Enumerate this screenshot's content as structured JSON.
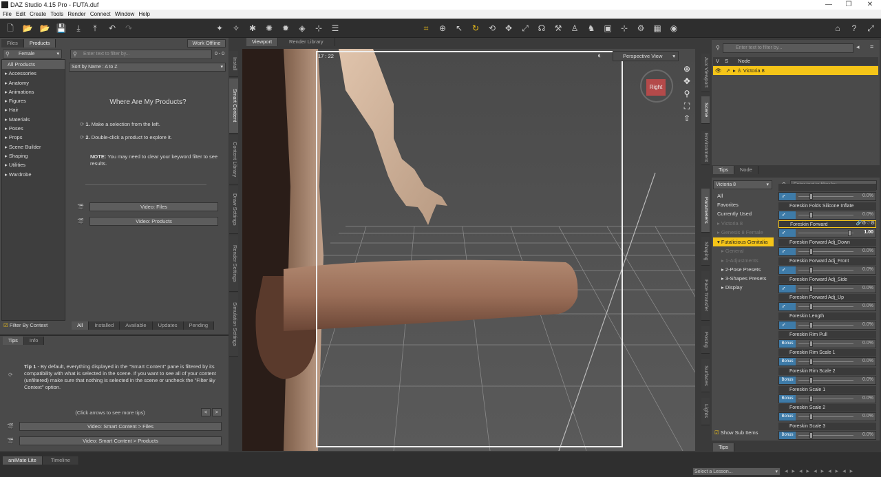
{
  "window": {
    "title": "DAZ Studio 4.15 Pro - FUTA.duf"
  },
  "menu": [
    "File",
    "Edit",
    "Create",
    "Tools",
    "Render",
    "Connect",
    "Window",
    "Help"
  ],
  "left": {
    "tabs": [
      "Files",
      "Products"
    ],
    "work_offline": "Work Offline",
    "category_select": "Female",
    "filter_placeholder": "Enter text to filter by...",
    "count": "0 - 0",
    "sort": "Sort by Name : A to Z",
    "categories": [
      "All Products",
      "Accessories",
      "Anatomy",
      "Animations",
      "Figures",
      "Hair",
      "Materials",
      "Poses",
      "Props",
      "Scene Builder",
      "Shaping",
      "Utilities",
      "Wardrobe"
    ],
    "where_title": "Where Are My Products?",
    "step1_num": "1.",
    "step1": "Make a selection from the left.",
    "step2_num": "2.",
    "step2": "Double-click a product to explore it.",
    "note_label": "NOTE:",
    "note": "You may need to clear your keyword filter to see results.",
    "video_files": "Video: Files",
    "video_products": "Video: Products",
    "filter_by_context": "Filter By Context",
    "bottom_tabs": [
      "All",
      "Installed",
      "Available",
      "Updates",
      "Pending"
    ]
  },
  "tips": {
    "tabs": [
      "Tips",
      "Info"
    ],
    "tip_label": "Tip 1",
    "tip_text": " - By default, everything displayed in the \"Smart Content\" pane is filtered by its compatibility with what is selected in the scene. If you want to see all of your content (unfiltered) make sure that nothing is selected in the scene or uncheck the \"Filter By Context\" option.",
    "more": "(Click arrows to see more tips)",
    "prev": "<",
    "next": ">",
    "video1": "Video: Smart Content > Files",
    "video2": "Video: Smart Content > Products"
  },
  "side_tabs_left": [
    "Install",
    "Smart Content",
    "Content Library",
    "Draw Settings",
    "Render Settings",
    "Simulation Settings"
  ],
  "viewport": {
    "tabs": [
      "Viewport",
      "Render Library"
    ],
    "frame": "17 : 22",
    "view": "Perspective View",
    "cube_label": "Right"
  },
  "scene": {
    "filter_placeholder": "Enter text to filter by...",
    "col_v": "V",
    "col_s": "S",
    "col_node": "Node",
    "node": "Victoria 8",
    "tabs": [
      "Tips",
      "Node"
    ]
  },
  "side_tabs_right": [
    "Aux Viewport",
    "Scene",
    "Environment",
    "Parameters",
    "Shaping",
    "Face Transfer",
    "Posing",
    "Surfaces",
    "Lights"
  ],
  "params": {
    "figure": "Victoria 8",
    "filter_placeholder": "Enter text to filter by...",
    "groups": [
      "All",
      "Favorites",
      "Currently Used",
      "Victoria 8",
      "Genesis 8 Female",
      "Futalicious Genitalia",
      "General",
      "1-Adjustments",
      "2-Pose Presets",
      "3-Shapes Presets",
      "Display"
    ],
    "show_sub": "Show Sub Items",
    "tips": "Tips",
    "items": [
      {
        "label": "",
        "value": "0.0%",
        "knob": 0.2
      },
      {
        "label": "Foreskin Folds Silicone Inflate",
        "value": "0.0%",
        "knob": 0.2
      },
      {
        "label": "Foreskin Forward",
        "value": "1.00",
        "knob": 0.9
      },
      {
        "label": "Foreskin Forward Adj_Down",
        "value": "0.0%",
        "knob": 0.2
      },
      {
        "label": "Foreskin Forward Adj_Front",
        "value": "0.0%",
        "knob": 0.2
      },
      {
        "label": "Foreskin Forward Adj_Side",
        "value": "0.0%",
        "knob": 0.2
      },
      {
        "label": "Foreskin Forward Adj_Up",
        "value": "0.0%",
        "knob": 0.2
      },
      {
        "label": "Foreskin Length",
        "value": "0.0%",
        "knob": 0.2
      },
      {
        "label": "Foreskin Rim Pull",
        "value": "0.0%",
        "knob": 0.2
      },
      {
        "label": "Foreskin Rim Scale 1",
        "value": "0.0%",
        "knob": 0.2
      },
      {
        "label": "Foreskin Rim Scale 2",
        "value": "0.0%",
        "knob": 0.2
      },
      {
        "label": "Foreskin Scale 1",
        "value": "0.0%",
        "knob": 0.2
      },
      {
        "label": "Foreskin Scale 2",
        "value": "0.0%",
        "knob": 0.2
      },
      {
        "label": "Foreskin Scale 3",
        "value": "0.0%",
        "knob": 0.2
      }
    ],
    "bonus": "Bonus"
  },
  "bottom": {
    "tabs": [
      "aniMate Lite",
      "Timeline"
    ],
    "lesson": "Select a Lesson..."
  },
  "colors": {
    "accent": "#f5c518",
    "panel": "#4a4a4a"
  }
}
